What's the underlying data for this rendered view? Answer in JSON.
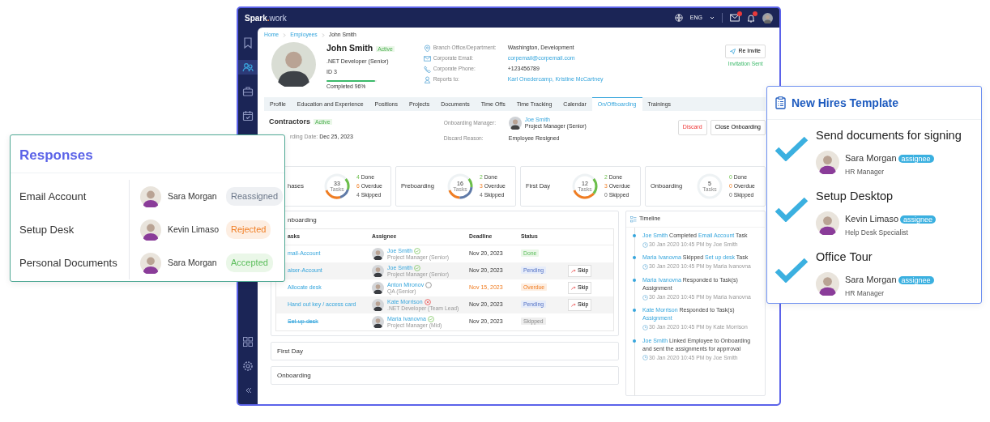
{
  "app": {
    "logo": {
      "name": "Spark",
      "dot": ".",
      "suffix": "work"
    },
    "language": "ENG",
    "mail_unread": true,
    "bell_unread": true
  },
  "sidebar": {
    "top": [
      {
        "kind": "bookmark",
        "selected": false
      },
      {
        "kind": "users",
        "selected": true
      },
      {
        "kind": "briefcase",
        "selected": false
      },
      {
        "kind": "calendar",
        "selected": false
      }
    ],
    "bottom": [
      {
        "kind": "grid",
        "selected": false
      },
      {
        "kind": "gear",
        "selected": false
      },
      {
        "kind": "collapse",
        "selected": false
      }
    ]
  },
  "breadcrumb": [
    "Home",
    "Employees",
    "John Smith"
  ],
  "profile": {
    "name": "John Smith",
    "status": "Active",
    "title": ".NET Developer (Senior)",
    "id": "ID 3",
    "level": 0.96,
    "completed": "Completed 96%"
  },
  "details": [
    {
      "kind": "location",
      "label": "Branch Office/Department:",
      "value": "Washington, Development",
      "link": false
    },
    {
      "kind": "email",
      "label": "Corporate Email:",
      "value": "corpemail@corpemail.com",
      "link": true
    },
    {
      "kind": "phone",
      "label": "Corporate Phone:",
      "value": "+123456789",
      "link": false
    },
    {
      "kind": "person",
      "label": "Reports to:",
      "value": "Karl Onedercamp, Kristine McCartney",
      "link": true
    }
  ],
  "reinvite": {
    "label": "Re Invite",
    "note": "Invitation Sent"
  },
  "tabs": [
    {
      "label": "Profile",
      "selected": false
    },
    {
      "label": "Education and Experience",
      "selected": false
    },
    {
      "label": "Positions",
      "selected": false
    },
    {
      "label": "Projects",
      "selected": false
    },
    {
      "label": "Documents",
      "selected": false
    },
    {
      "label": "Time Offs",
      "selected": false
    },
    {
      "label": "Time Tracking",
      "selected": false
    },
    {
      "label": "Calendar",
      "selected": false
    },
    {
      "label": "On/Offboarding",
      "selected": true
    },
    {
      "label": "Trainings",
      "selected": false
    }
  ],
  "onboarding": {
    "title": "Contractors",
    "status": "Active",
    "date_label": "rding Date:",
    "date": "Dec 25, 2023",
    "manager_label": "Onboarding Manager:",
    "manager_name": "Joe Smith",
    "manager_role": "Project Manager (Senior)",
    "reason_label": "Discard Reason:",
    "reason": "Employee Resigned",
    "buttons": [
      {
        "label": "Discard",
        "kind": "danger"
      },
      {
        "label": "Close Onboarding",
        "kind": "plain"
      }
    ]
  },
  "phases": [
    {
      "name": "hases",
      "total": "33",
      "unit": "Tasks",
      "stats": [
        {
          "count": "4",
          "label": "Done",
          "kind": "done"
        },
        {
          "count": "6",
          "label": "Overdue",
          "kind": "overdue"
        },
        {
          "count": "4",
          "label": "Skipped",
          "kind": "skipped"
        }
      ]
    },
    {
      "name": "Preboarding",
      "total": "16",
      "unit": "Tasks",
      "stats": [
        {
          "count": "2",
          "label": "Done",
          "kind": "done"
        },
        {
          "count": "3",
          "label": "Overdue",
          "kind": "overdue"
        },
        {
          "count": "4",
          "label": "Skipped",
          "kind": "skipped"
        }
      ]
    },
    {
      "name": "First Day",
      "total": "12",
      "unit": "Tasks",
      "stats": [
        {
          "count": "2",
          "label": "Done",
          "kind": "done"
        },
        {
          "count": "3",
          "label": "Overdue",
          "kind": "overdue"
        },
        {
          "count": "0",
          "label": "Skipped",
          "kind": "skipped"
        }
      ]
    },
    {
      "name": "Onboarding",
      "total": "5",
      "unit": "Tasks",
      "stats": [
        {
          "count": "0",
          "label": "Done",
          "kind": "done"
        },
        {
          "count": "0",
          "label": "Overdue",
          "kind": "overdue"
        },
        {
          "count": "0",
          "label": "Skipped",
          "kind": "skipped"
        }
      ]
    }
  ],
  "sections": [
    {
      "title": "nboarding",
      "expanded": true
    },
    {
      "title": "First Day",
      "expanded": false
    },
    {
      "title": "Onboarding",
      "expanded": false
    }
  ],
  "table": {
    "columns": [
      "asks",
      "Assignee",
      "Deadline",
      "Status"
    ],
    "rows": [
      {
        "task": "mail-Account",
        "struck": false,
        "assignee": "Joe Smith",
        "role": "Project Manager (Senior)",
        "response": {
          "kind": "accepted"
        },
        "deadline": "Nov 20, 2023",
        "overdue": false,
        "status": {
          "text": "Done",
          "kind": "done"
        }
      },
      {
        "task": "aiser-Account",
        "struck": false,
        "assignee": "Joe Smith",
        "role": "Project Manager (Senior)",
        "response": {
          "kind": "accepted"
        },
        "deadline": "Nov 20, 2023",
        "overdue": false,
        "status": {
          "text": "Pending",
          "kind": "pending"
        },
        "action": "Skip"
      },
      {
        "task": "Allocate desk",
        "struck": false,
        "assignee": "Anton Mironov",
        "role": "QA (Senior)",
        "response": {
          "kind": "none"
        },
        "deadline": "Nov 15, 2023",
        "overdue": true,
        "status": {
          "text": "Overdue",
          "kind": "overdue"
        },
        "action": "Skip"
      },
      {
        "task": "Hand out key / access card",
        "struck": false,
        "assignee": "Kate Morrison",
        "role": ".NET Developer (Team Lead)",
        "response": {
          "kind": "rejected"
        },
        "deadline": "Nov 20, 2023",
        "overdue": false,
        "status": {
          "text": "Pending",
          "kind": "pending"
        },
        "action": "Skip"
      },
      {
        "task": "Set-up-desk",
        "struck": true,
        "assignee": "Maria Ivanovna",
        "role": "Project Manager (Mid)",
        "response": {
          "kind": "accepted"
        },
        "deadline": "Nov 20, 2023",
        "overdue": false,
        "status": {
          "text": "Skipped",
          "kind": "skipped"
        }
      }
    ]
  },
  "timeline": {
    "title": "Timeline",
    "entries": [
      {
        "parts": [
          {
            "text": "Joe Smith",
            "link": true
          },
          {
            "text": "Completed",
            "link": false
          },
          {
            "text": "Email Account",
            "link": true
          },
          {
            "text": "Task",
            "link": false
          }
        ],
        "meta": "30 Jan 2020 10:45 PM by Joe Smith"
      },
      {
        "parts": [
          {
            "text": "Maria Ivanovna",
            "link": true
          },
          {
            "text": "Skipped",
            "link": false
          },
          {
            "text": "Set up desk",
            "link": true
          },
          {
            "text": "Task",
            "link": false
          }
        ],
        "meta": "30 Jan 2020 10:45 PM by Maria Ivanovna"
      },
      {
        "parts": [
          {
            "text": "Maria Ivanovna",
            "link": true
          },
          {
            "text": "Responded to Task(s) Assignment",
            "link": false
          }
        ],
        "meta": "30 Jan 2020 10:45 PM by Maria Ivanovna"
      },
      {
        "parts": [
          {
            "text": "Kate Morrison",
            "link": true
          },
          {
            "text": "Responded to Task(s)",
            "link": false
          },
          {
            "text": "Assignment",
            "link": true
          }
        ],
        "meta": "30 Jan 2020 10:45 PM by Kate Morrison"
      },
      {
        "parts": [
          {
            "text": "Joe Smith",
            "link": true
          },
          {
            "text": "Linked Employee to Onboarding and sent the assignments for apprroval",
            "link": false
          }
        ],
        "meta": "30 Jan 2020 10:45 PM by Joe Smith"
      }
    ]
  },
  "responses": {
    "title": "Responses",
    "rows": [
      {
        "task": "Email Account",
        "person": "Sara Morgan",
        "status": "Reassigned",
        "kind": "reassigned"
      },
      {
        "task": "Setup Desk",
        "person": "Kevin Limaso",
        "status": "Rejected",
        "kind": "rejected"
      },
      {
        "task": "Personal Documents",
        "person": "Sara Morgan",
        "status": "Accepted",
        "kind": "accepted"
      }
    ]
  },
  "template": {
    "title": "New Hires Template",
    "items": [
      {
        "title": "Send documents for signing",
        "person": "Sara Morgan",
        "badge": "assignee",
        "role": "HR Manager",
        "checked": true
      },
      {
        "title": "Setup Desktop",
        "person": "Kevin Limaso",
        "badge": "assignee",
        "role": "Help Desk Specialist",
        "checked": true
      },
      {
        "title": "Office Tour",
        "person": "Sara Morgan",
        "badge": "assignee",
        "role": "HR Manager",
        "checked": true
      }
    ]
  }
}
